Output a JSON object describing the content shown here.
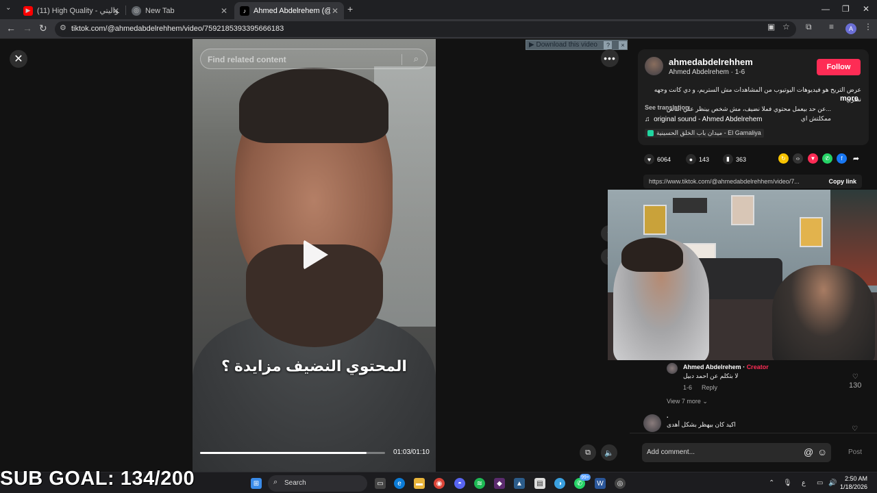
{
  "browser": {
    "tabs": [
      {
        "label": "(11) High Quality - عماي كواليتي",
        "active": false
      },
      {
        "label": "New Tab",
        "active": false
      },
      {
        "label": "Ahmed Abdelrehem (@ahmedab",
        "active": true
      }
    ],
    "url": "tiktok.com/@ahmedabdelrehhem/video/7592185393395666183",
    "profile_initial": "A"
  },
  "video": {
    "search_placeholder": "Find related content",
    "caption": "المحتوي النضيف مزايدة ؟",
    "time": "01:03/01:10",
    "progress": 0.9,
    "download_label": "▶ Download this video",
    "download_help": "?",
    "download_close": "×"
  },
  "post": {
    "handle": "ahmedabdelrehhem",
    "subtitle": "Ahmed Abdelrehem · 1-6",
    "follow_label": "Follow",
    "description_line1": "عرض التريح هو فيديوهات اليوتيوب من المشاهدات مش الستريم، و دي كانت وجهه نظري",
    "description_line2": "...عن حد بيعمل محتوي فملا نضيف، مش شخص بينظر علي الناس ممكلتش اي",
    "more_label": "more",
    "see_translation": "See translation",
    "sound": "original sound - Ahmed Abdelrehem",
    "location": "ميدان باب الخلق الحسينية - El Gamaliya",
    "likes": "6064",
    "comments": "143",
    "saves": "363",
    "link": "https://www.tiktok.com/@ahmedabdelrehhem/video/7...",
    "copy_link": "Copy link"
  },
  "comments": [
    {
      "name": "Ahmed Abdelrehem",
      "creator_tag": "Creator",
      "text": "لا بتكلم عن احمد دبيل",
      "date": "1-6",
      "reply": "Reply",
      "likes": "130"
    },
    {
      "name": ".",
      "text": "اكيد كان بيهظر بشكل أهدى"
    }
  ],
  "view_more": "View 7 more",
  "add_comment_placeholder": "Add comment...",
  "post_label": "Post",
  "overlay": {
    "sub_goal": "SUB GOAL: 134/200"
  },
  "taskbar": {
    "search_label": "Search",
    "time": "2:50 AM",
    "date": "1/18/2026",
    "lang": "ع",
    "badge": "99+"
  }
}
